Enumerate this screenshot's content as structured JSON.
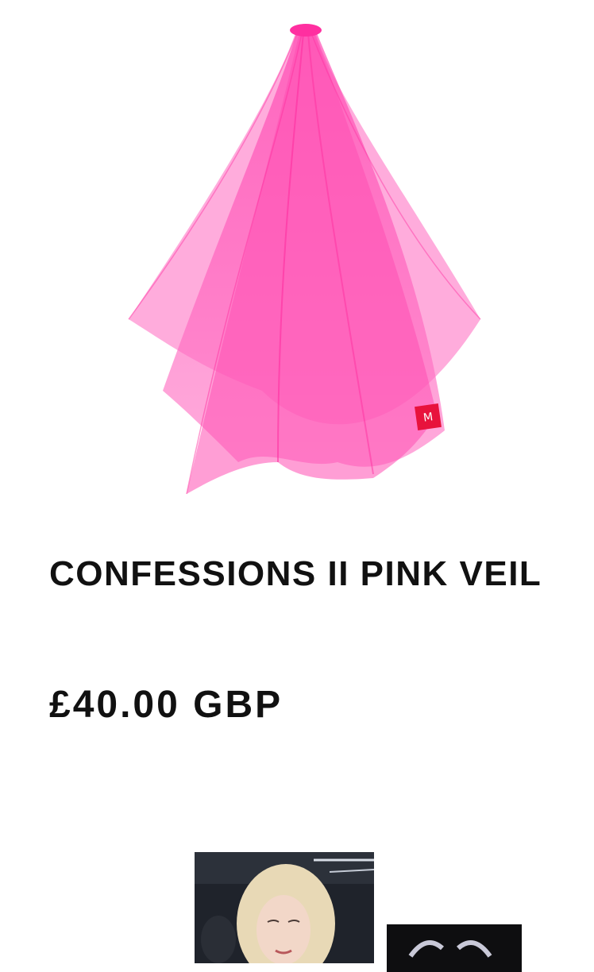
{
  "product": {
    "title": "CONFESSIONS II PINK VEIL",
    "price": "£40.00 GBP",
    "image_icon": "pink-veil-image",
    "veil_color": "#ff4fb3",
    "tag_color": "#e8123c"
  },
  "related": {
    "items": [
      {
        "icon": "portrait-photo"
      },
      {
        "icon": "product-photo"
      }
    ]
  }
}
